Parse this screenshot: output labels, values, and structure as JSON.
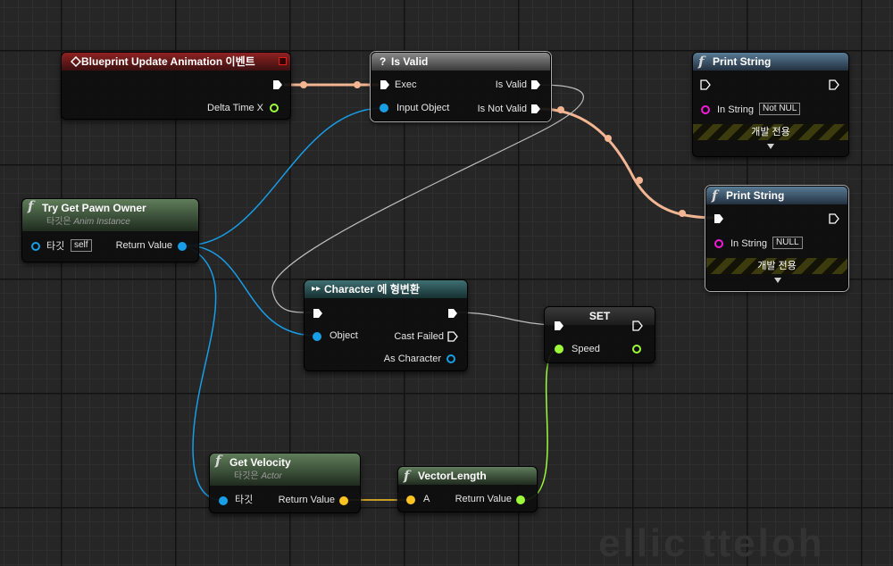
{
  "nodes": {
    "event": {
      "title": "Blueprint Update Animation 이벤트",
      "pins": {
        "delta": "Delta Time X"
      }
    },
    "is_valid": {
      "title": "Is Valid",
      "title_icon": "?",
      "pins": {
        "exec": "Exec",
        "input_object": "Input Object",
        "is_valid": "Is Valid",
        "is_not_valid": "Is Not Valid"
      }
    },
    "print_top": {
      "title": "Print String",
      "pins": {
        "in_string": "In String"
      },
      "in_string_value": "Not NUL",
      "dev_only": "개발 전용"
    },
    "print_mid": {
      "title": "Print String",
      "pins": {
        "in_string": "In String"
      },
      "in_string_value": "NULL",
      "dev_only": "개발 전용"
    },
    "try_get": {
      "title": "Try Get Pawn Owner",
      "subtitle_kr": "타깃은",
      "subtitle_en": "Anim Instance",
      "pins": {
        "target": "타깃",
        "return": "Return Value"
      },
      "target_value": "self"
    },
    "cast": {
      "title": "Character 에 형변환",
      "pins": {
        "object": "Object",
        "cast_failed": "Cast Failed",
        "as_character": "As Character"
      }
    },
    "set": {
      "title": "SET",
      "pins": {
        "speed": "Speed"
      }
    },
    "velocity": {
      "title": "Get Velocity",
      "subtitle_kr": "타깃은",
      "subtitle_en": "Actor",
      "pins": {
        "target": "타깃",
        "return": "Return Value"
      }
    },
    "vlen": {
      "title": "VectorLength",
      "pins": {
        "a": "A",
        "return": "Return Value"
      }
    }
  },
  "colors": {
    "exec": "#ffffff",
    "exec_wire_active": "#f3b592",
    "exec_wire_idle": "#cfcfcf",
    "object": "#179ee6",
    "float": "#9dfa3a",
    "vector": "#fcc323",
    "string": "#f31ad9",
    "event_marker": "#e81a1a"
  },
  "icons": {
    "function": "f",
    "event": "event-diamond-icon",
    "cast": "cast-arrows-icon"
  }
}
